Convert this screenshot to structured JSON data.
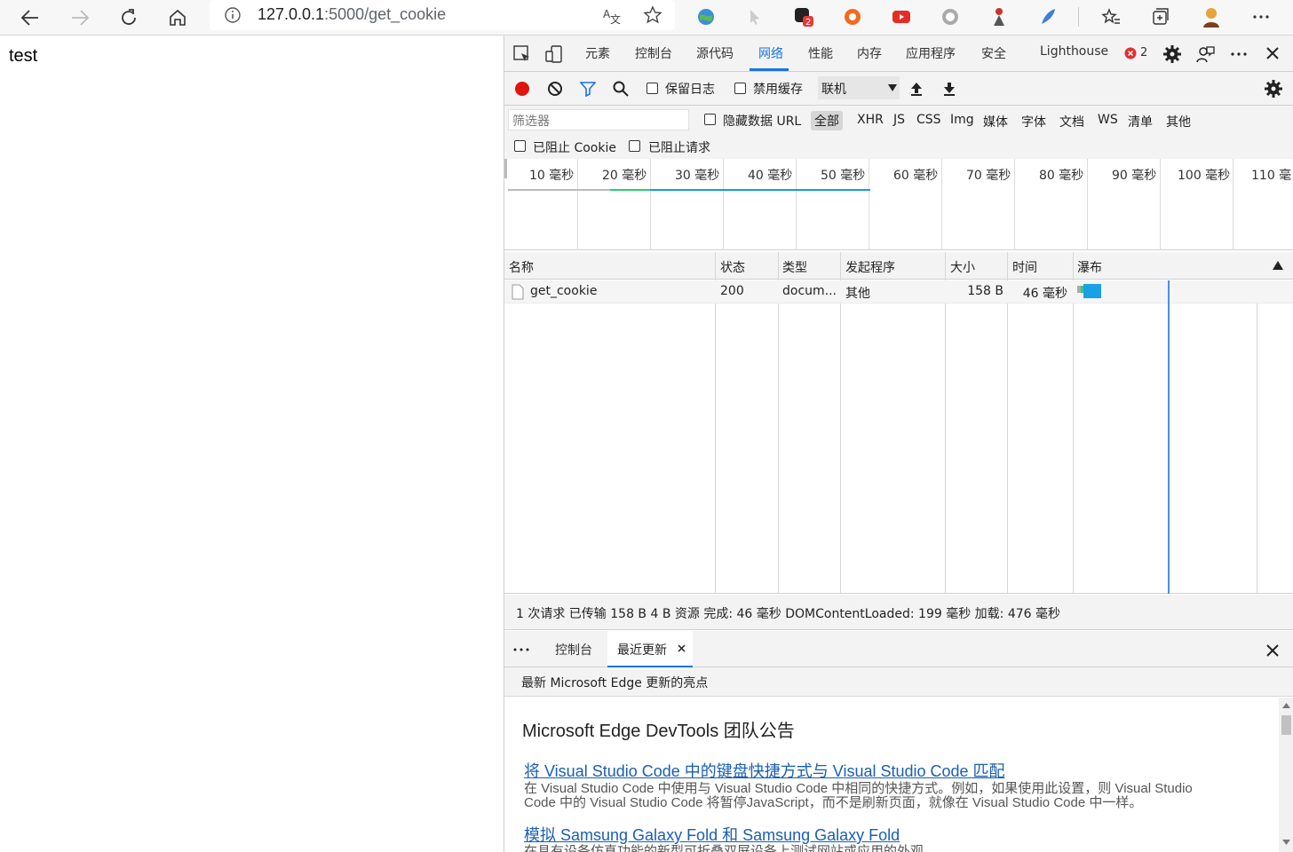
{
  "browser": {
    "address": {
      "host": "127.0.0.1",
      "path": ":5000/get_cookie"
    }
  },
  "page": {
    "text": "test"
  },
  "devtools": {
    "tabs": [
      "元素",
      "控制台",
      "源代码",
      "网络",
      "性能",
      "内存",
      "应用程序",
      "安全",
      "Lighthouse"
    ],
    "active_tab": "网络",
    "error_count": "2",
    "toolbar": {
      "preserve_log": "保留日志",
      "disable_cache": "禁用缓存",
      "throttle": "联机"
    },
    "filter": {
      "placeholder": "筛选器",
      "hide_data_url": "隐藏数据 URL",
      "types": [
        "全部",
        "XHR",
        "JS",
        "CSS",
        "Img",
        "媒体",
        "字体",
        "文档",
        "WS",
        "清单",
        "其他"
      ],
      "blocked_cookie": "已阻止 Cookie",
      "blocked_requests": "已阻止请求"
    },
    "overview_ticks": [
      "10 毫秒",
      "20 毫秒",
      "30 毫秒",
      "40 毫秒",
      "50 毫秒",
      "60 毫秒",
      "70 毫秒",
      "80 毫秒",
      "90 毫秒",
      "100 毫秒",
      "110 毫"
    ],
    "columns": [
      "名称",
      "状态",
      "类型",
      "发起程序",
      "大小",
      "时间",
      "瀑布"
    ],
    "requests": [
      {
        "name": "get_cookie",
        "status": "200",
        "type": "docum...",
        "initiator": "其他",
        "size": "158 B",
        "time": "46 毫秒"
      }
    ],
    "summary": "1 次请求  已传输 158 B  4 B 资源  完成: 46 毫秒  DOMContentLoaded: 199 毫秒  加载: 476 毫秒",
    "drawer": {
      "tabs": [
        "控制台",
        "最近更新"
      ],
      "active_tab": "最近更新",
      "subtitle": "最新 Microsoft Edge 更新的亮点",
      "heading": "Microsoft Edge DevTools 团队公告",
      "items": [
        {
          "title": "将 Visual Studio Code 中的键盘快捷方式与 Visual Studio Code 匹配",
          "desc_line1": "在 Visual Studio Code 中使用与 Visual Studio Code 中相同的快捷方式。例如，如果使用此设置，则 Visual Studio",
          "desc_line2": "Code 中的 Visual Studio Code 将暂停JavaScript，而不是刷新页面，就像在 Visual Studio Code 中一样。"
        },
        {
          "title": "模拟 Samsung Galaxy Fold 和 Samsung Galaxy Fold",
          "desc_line1": "在具有设备仿真功能的新型可折叠双屏设备上测试网站或应用的外观。"
        }
      ]
    }
  },
  "colors": {
    "accent": "#1a73e8",
    "record": "#e0140e",
    "link": "#1a5fb4"
  }
}
